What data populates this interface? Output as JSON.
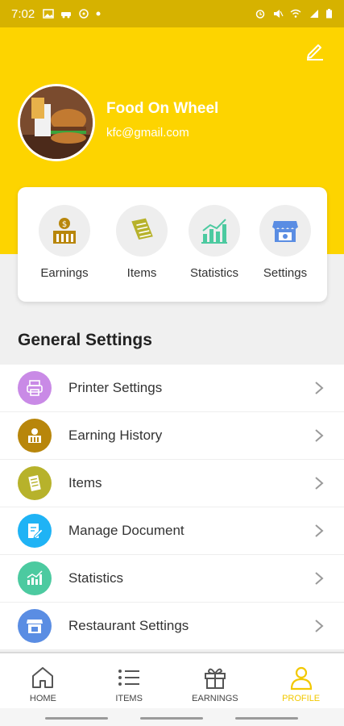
{
  "status_bar": {
    "time": "7:02",
    "left_icons": [
      "gallery-icon",
      "car-icon",
      "steering-icon",
      "dot-icon"
    ],
    "right_icons": [
      "alarm-icon",
      "mute-icon",
      "wifi-icon",
      "signal-icon",
      "battery-icon"
    ]
  },
  "header": {
    "restaurant_name": "Food On Wheel",
    "email": "kfc@gmail.com",
    "edit_icon": "pencil-icon",
    "background": "#fdd400"
  },
  "quick_actions": [
    {
      "label": "Earnings",
      "icon": "money-bag-icon"
    },
    {
      "label": "Items",
      "icon": "document-list-icon"
    },
    {
      "label": "Statistics",
      "icon": "bar-chart-icon"
    },
    {
      "label": "Settings",
      "icon": "storefront-icon"
    }
  ],
  "general_settings": {
    "title": "General Settings",
    "items": [
      {
        "label": "Printer Settings",
        "icon": "printer-icon",
        "color": "#c98ae6"
      },
      {
        "label": "Earning History",
        "icon": "money-bag-icon",
        "color": "#b8860b"
      },
      {
        "label": "Items",
        "icon": "document-list-icon",
        "color": "#b7b22b"
      },
      {
        "label": "Manage Document",
        "icon": "edit-document-icon",
        "color": "#1fb3f5"
      },
      {
        "label": "Statistics",
        "icon": "bar-chart-icon",
        "color": "#4ccaa0"
      },
      {
        "label": "Restaurant Settings",
        "icon": "storefront-icon",
        "color": "#5a8de3"
      }
    ]
  },
  "bottom_nav": {
    "items": [
      {
        "label": "HOME",
        "icon": "home-icon"
      },
      {
        "label": "ITEMS",
        "icon": "list-icon"
      },
      {
        "label": "EARNINGS",
        "icon": "gift-icon"
      },
      {
        "label": "PROFILE",
        "icon": "user-icon"
      }
    ],
    "active": "PROFILE",
    "active_color": "#f2c800"
  }
}
